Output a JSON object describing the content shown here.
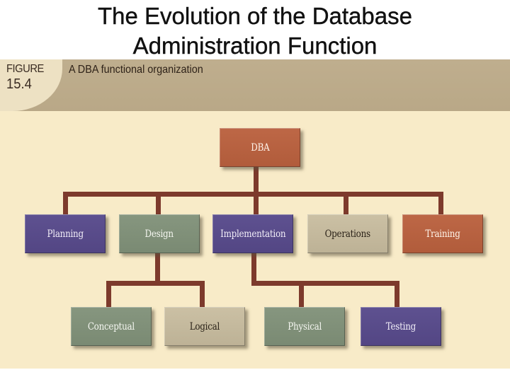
{
  "slide": {
    "title_line1": "The Evolution of the Database",
    "title_line2": "Administration Function"
  },
  "figure": {
    "label_word": "FIGURE",
    "label_number": "15.4",
    "caption": "A DBA functional organization"
  },
  "colors": {
    "background": "#f8ebc8",
    "band": "#bcab8a",
    "connector": "#7d3a2c",
    "rust": "#b5603f",
    "purple": "#574a86",
    "green": "#7f8f78",
    "tan": "#c3b89c"
  },
  "org_chart": {
    "root": {
      "label": "DBA",
      "color": "rust"
    },
    "functions": [
      {
        "label": "Planning",
        "color": "purple",
        "children": []
      },
      {
        "label": "Design",
        "color": "green",
        "children": [
          {
            "label": "Conceptual",
            "color": "green"
          },
          {
            "label": "Logical",
            "color": "tan"
          }
        ]
      },
      {
        "label": "Implementation",
        "color": "purple",
        "children": [
          {
            "label": "Physical",
            "color": "green"
          },
          {
            "label": "Testing",
            "color": "purple"
          }
        ]
      },
      {
        "label": "Operations",
        "color": "tan",
        "children": []
      },
      {
        "label": "Training",
        "color": "rust",
        "children": []
      }
    ]
  }
}
